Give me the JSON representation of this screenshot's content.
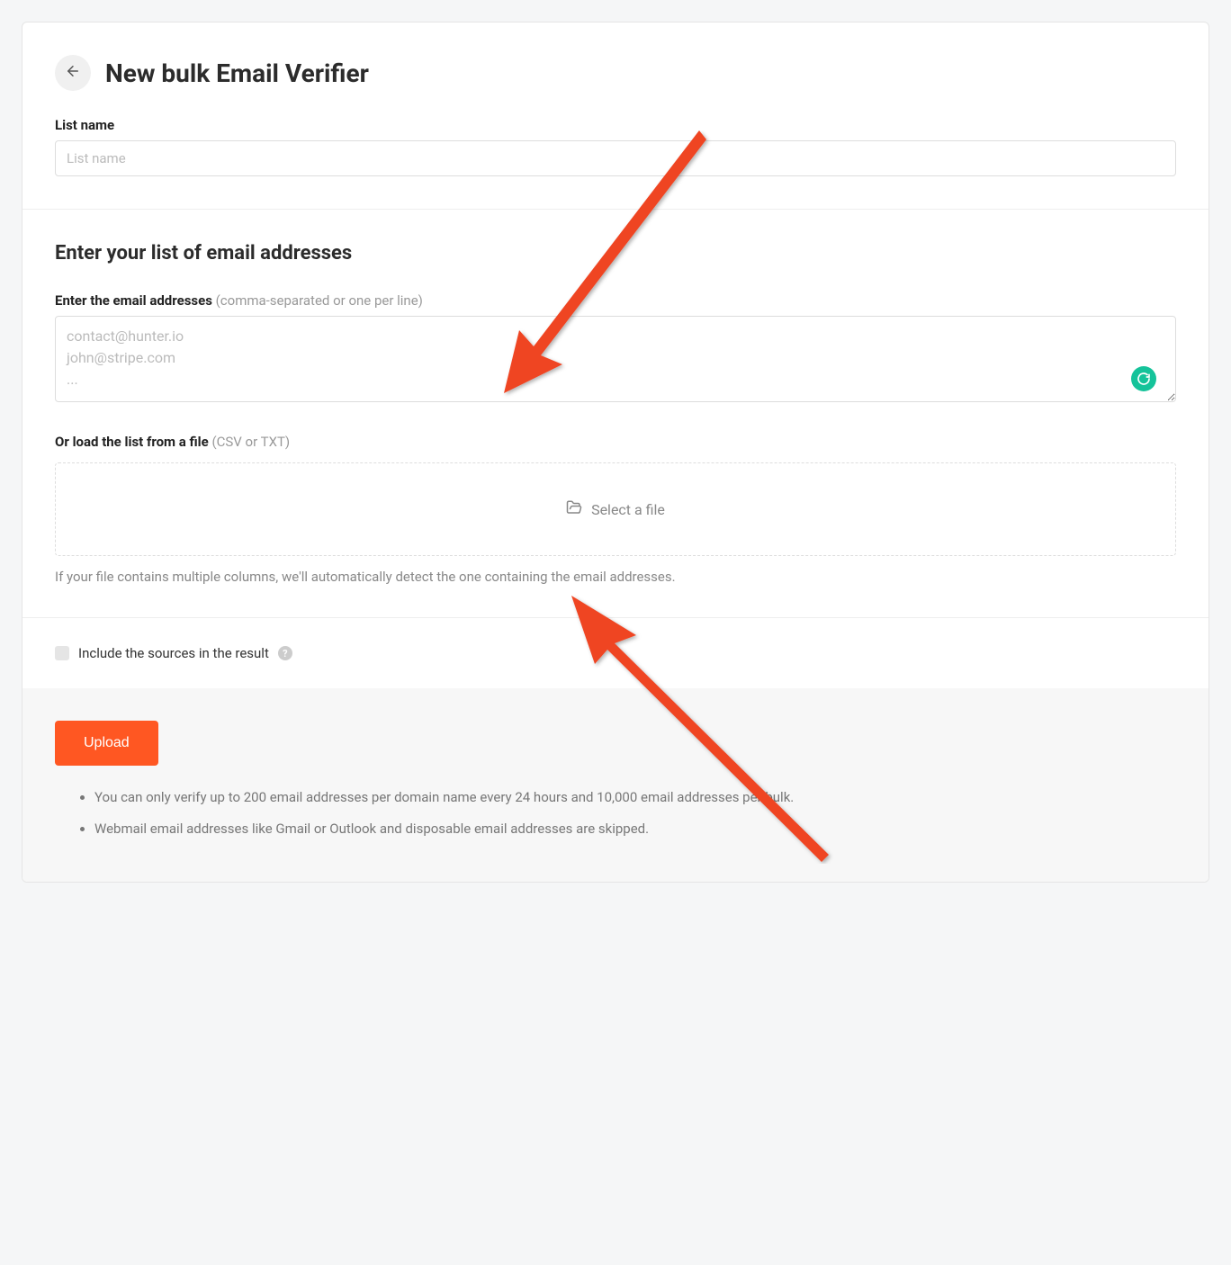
{
  "header": {
    "title": "New bulk Email Verifier"
  },
  "listName": {
    "label": "List name",
    "placeholder": "List name"
  },
  "emailSection": {
    "heading": "Enter your list of email addresses",
    "enterLabel": "Enter the email addresses",
    "enterHint": " (comma-separated or one per line)",
    "placeholder": "contact@hunter.io\njohn@stripe.com\n...",
    "fileLabel": "Or load the list from a file",
    "fileHint": " (CSV or TXT)",
    "selectFile": "Select a file",
    "fileHelp": "If your file contains multiple columns, we'll automatically detect the one containing the email addresses."
  },
  "options": {
    "includeSources": "Include the sources in the result"
  },
  "footer": {
    "uploadLabel": "Upload",
    "notes": [
      "You can only verify up to 200 email addresses per domain name every 24 hours and 10,000 email addresses per bulk.",
      "Webmail email addresses like Gmail or Outlook and disposable email addresses are skipped."
    ]
  }
}
